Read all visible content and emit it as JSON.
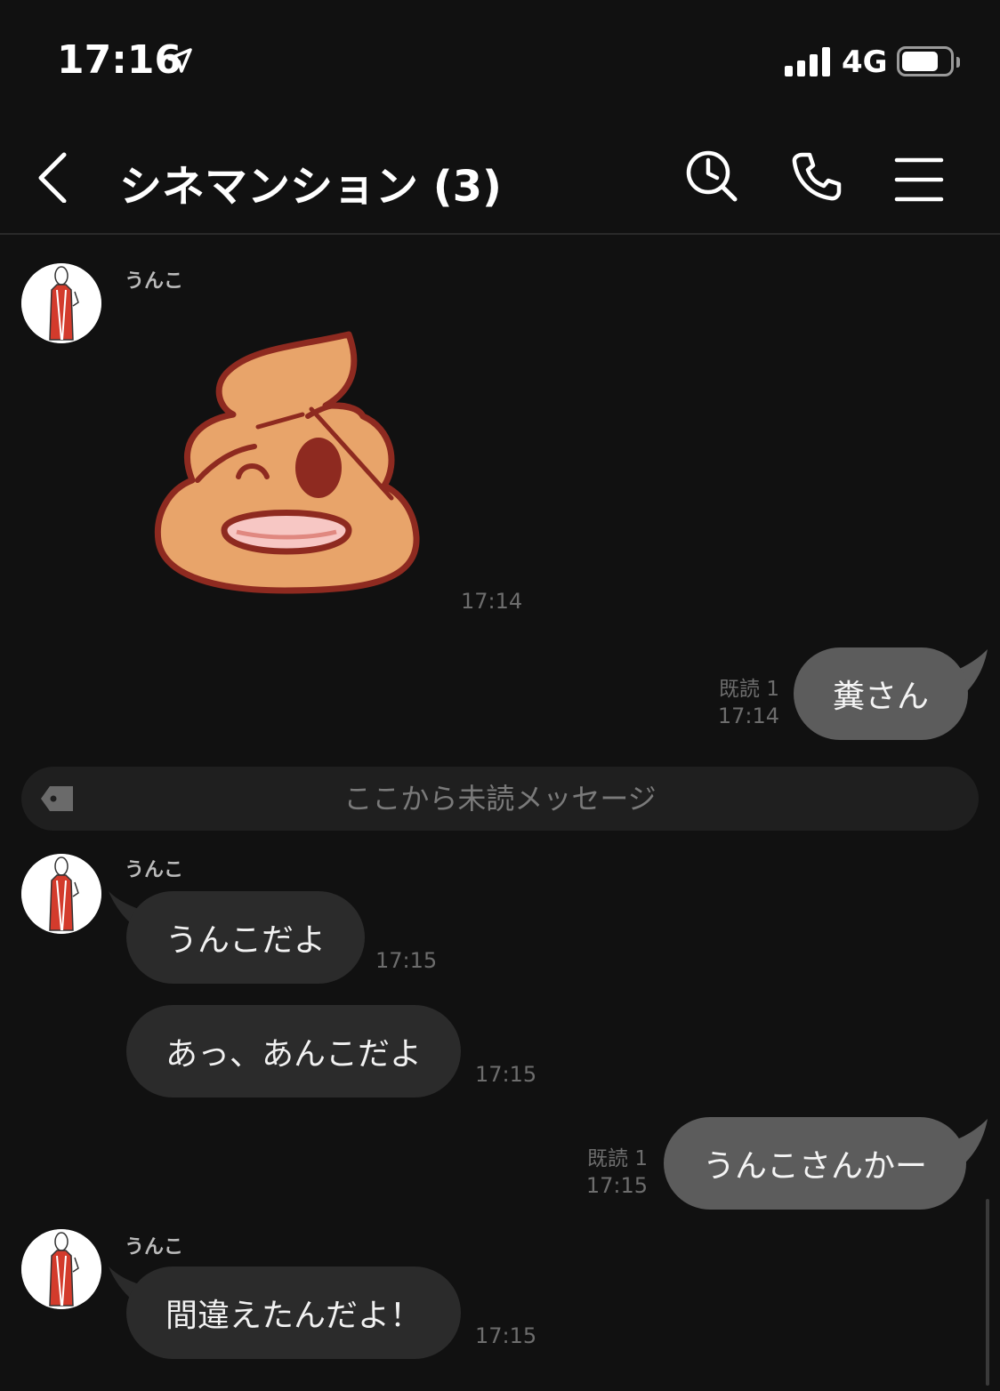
{
  "status_bar": {
    "time": "17:16",
    "network": "4G"
  },
  "header": {
    "title": "シネマンション (3)"
  },
  "messages": [
    {
      "sender": "うんこ",
      "time": "17:14"
    },
    {
      "text": "糞さん",
      "read": "既読 1",
      "time": "17:14"
    },
    {
      "sender": "うんこ",
      "text": "うんこだよ",
      "time": "17:15"
    },
    {
      "text": "あっ、あんこだよ",
      "time": "17:15"
    },
    {
      "text": "うんこさんかー",
      "read": "既読 1",
      "time": "17:15"
    },
    {
      "sender": "うんこ",
      "text": "間違えたんだよ！",
      "time": "17:15"
    }
  ],
  "unread_divider": "ここから未読メッセージ",
  "icons": {
    "location": "location-arrow-icon",
    "back": "chevron-left-icon",
    "search": "search-icon",
    "call": "phone-icon",
    "menu": "hamburger-menu-icon",
    "tag": "tag-icon"
  }
}
